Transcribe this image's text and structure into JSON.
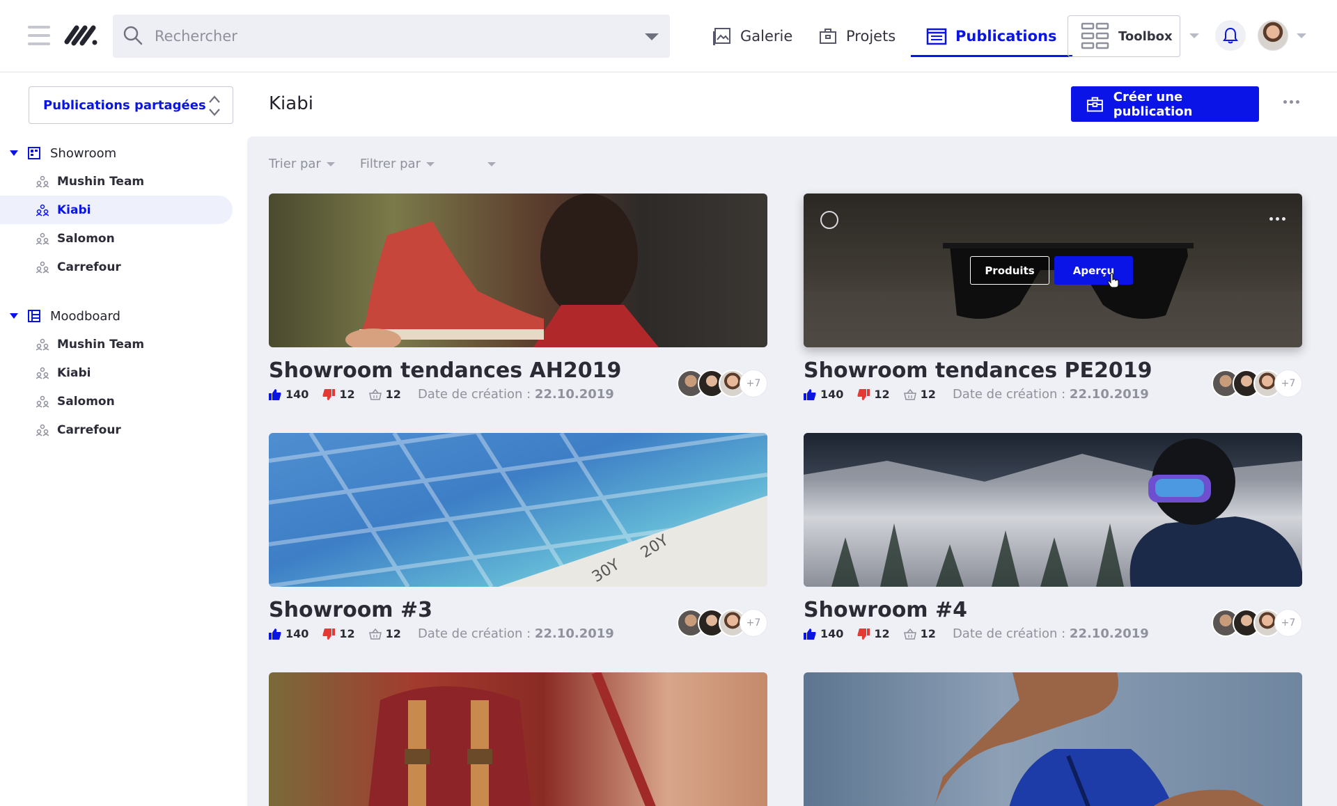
{
  "topbar": {
    "search_placeholder": "Rechercher",
    "nav": {
      "galerie": "Galerie",
      "projets": "Projets",
      "publications": "Publications"
    },
    "toolbox": "Toolbox"
  },
  "sidebar": {
    "shared_select": "Publications partagées",
    "groups": [
      {
        "label": "Showroom",
        "items": [
          "Mushin Team",
          "Kiabi",
          "Salomon",
          "Carrefour"
        ]
      },
      {
        "label": "Moodboard",
        "items": [
          "Mushin Team",
          "Kiabi",
          "Salomon",
          "Carrefour"
        ]
      }
    ],
    "active_item": "Kiabi"
  },
  "main": {
    "title": "Kiabi",
    "create_button": "Créer une publication",
    "filters": {
      "sort": "Trier par",
      "filter": "Filtrer par"
    },
    "cards": [
      {
        "title": "Showroom tendances AH2019",
        "likes": "140",
        "dislikes": "12",
        "baskets": "12",
        "date_label": "Date de création :",
        "date": "22.10.2019",
        "more_people": "+7"
      },
      {
        "title": "Showroom tendances PE2019",
        "likes": "140",
        "dislikes": "12",
        "baskets": "12",
        "date_label": "Date de création :",
        "date": "22.10.2019",
        "more_people": "+7",
        "overlay": {
          "produits": "Produits",
          "apercu": "Aperçu"
        }
      },
      {
        "title": "Showroom #3",
        "likes": "140",
        "dislikes": "12",
        "baskets": "12",
        "date_label": "Date de création :",
        "date": "22.10.2019",
        "more_people": "+7"
      },
      {
        "title": "Showroom #4",
        "likes": "140",
        "dislikes": "12",
        "baskets": "12",
        "date_label": "Date de création :",
        "date": "22.10.2019",
        "more_people": "+7"
      }
    ]
  },
  "colors": {
    "accent": "#0a14e6",
    "background": "#eef0f5",
    "like": "#0a14e6",
    "dislike": "#e53935"
  }
}
